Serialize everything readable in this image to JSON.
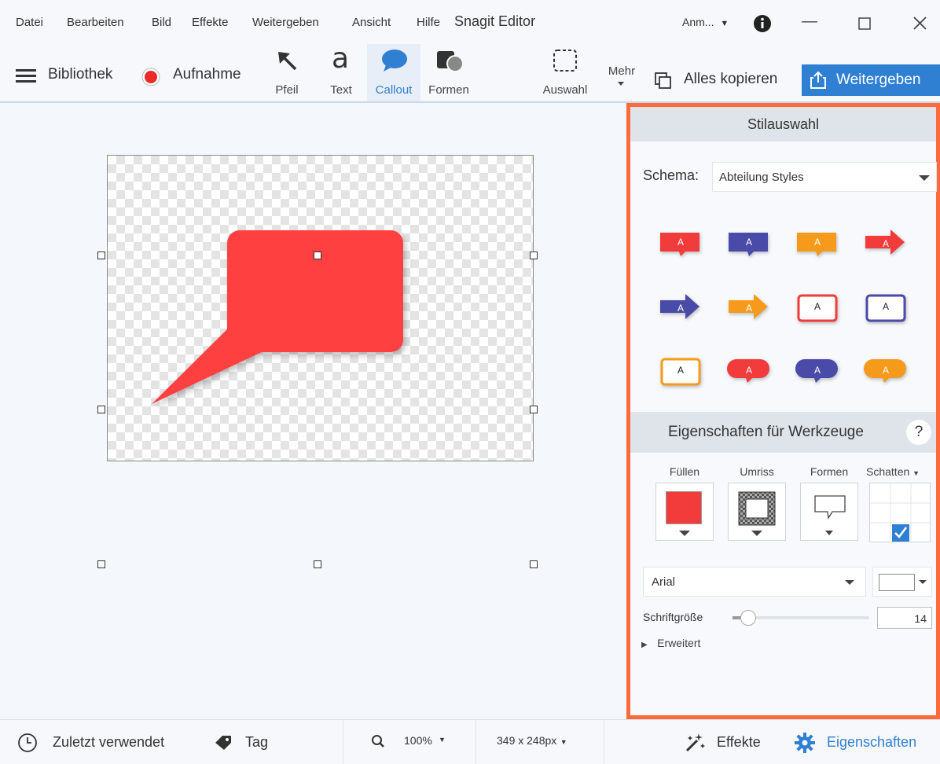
{
  "menubar": {
    "items": [
      "Datei",
      "Bearbeiten",
      "Bild",
      "Effekte",
      "Weitergeben",
      "Ansicht",
      "Hilfe"
    ],
    "app_title": "Snagit Editor",
    "account": "Anm...",
    "icons": [
      "info-icon",
      "minimize-icon",
      "maximize-icon",
      "close-icon"
    ]
  },
  "toolbar": {
    "library": "Bibliothek",
    "capture": "Aufnahme",
    "tools": [
      {
        "label": "Pfeil",
        "icon": "arrow-icon"
      },
      {
        "label": "Text",
        "icon": "text-icon"
      },
      {
        "label": "Callout",
        "icon": "callout-icon",
        "active": true
      },
      {
        "label": "Formen",
        "icon": "shapes-icon"
      },
      {
        "label": "Auswahl",
        "icon": "selection-icon"
      }
    ],
    "more": "Mehr",
    "copy_all": "Alles kopieren",
    "share": "Weitergeben",
    "accent_color": "#2f7fd3"
  },
  "panel": {
    "style_header": "Stilauswahl",
    "scheme_label": "Schema:",
    "scheme_value": "Abteilung Styles",
    "style_letter": "A",
    "styles": [
      {
        "shape": "callout",
        "color": "#f23b3b"
      },
      {
        "shape": "callout",
        "color": "#4a4aa8"
      },
      {
        "shape": "callout",
        "color": "#f59a1b"
      },
      {
        "shape": "arrow",
        "color": "#f23b3b"
      },
      {
        "shape": "arrow",
        "color": "#4a4aa8"
      },
      {
        "shape": "arrow",
        "color": "#f59a1b"
      },
      {
        "shape": "outline",
        "color": "#f23b3b"
      },
      {
        "shape": "outline",
        "color": "#4a4aa8"
      },
      {
        "shape": "outline",
        "color": "#f59a1b"
      },
      {
        "shape": "oval",
        "color": "#f23b3b"
      },
      {
        "shape": "oval",
        "color": "#4a4aa8"
      },
      {
        "shape": "oval",
        "color": "#f59a1b"
      }
    ],
    "props_header": "Eigenschaften für Werkzeuge",
    "help": "?",
    "fill_label": "Füllen",
    "fill_color": "#f23b3b",
    "outline_label": "Umriss",
    "shape_label": "Formen",
    "shadow_label": "Schatten",
    "font_value": "Arial",
    "font_size_label": "Schriftgröße",
    "font_size_value": "14",
    "advanced_label": "Erweitert"
  },
  "canvas": {
    "callout_color": "#ff4040"
  },
  "statusbar": {
    "recent": "Zuletzt verwendet",
    "tag": "Tag",
    "zoom": "100%",
    "dimensions": "349 x 248px",
    "effects": "Effekte",
    "properties": "Eigenschaften"
  }
}
